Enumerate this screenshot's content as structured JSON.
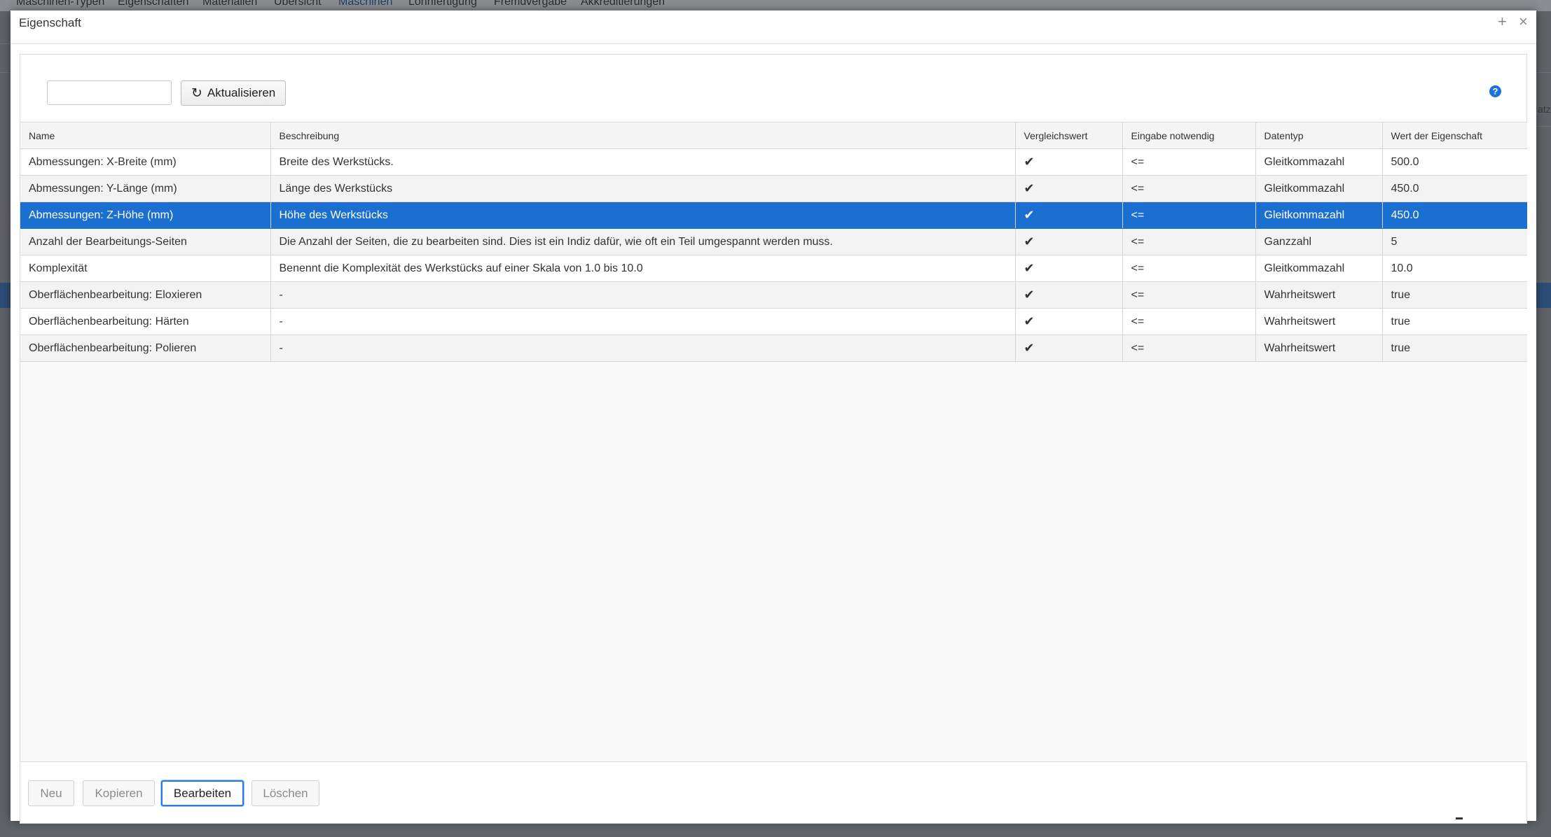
{
  "background": {
    "nav_items": [
      "Maschinen-Typen",
      "Eigenschaften",
      "Materialien",
      "Übersicht",
      "Maschinen",
      "Lohnfertigung",
      "Fremdvergabe",
      "Akkreditierungen"
    ],
    "active_nav": "Maschinen",
    "right_fragment": "atz"
  },
  "dialog": {
    "title": "Eigenschaft",
    "maximize_glyph": "+",
    "close_glyph": "×"
  },
  "toolbar": {
    "search_value": "",
    "refresh_label": "Aktualisieren",
    "refresh_icon": "refresh-icon",
    "help_glyph": "?"
  },
  "table": {
    "columns": [
      "Name",
      "Beschreibung",
      "Vergleichswert",
      "Eingabe notwendig",
      "Datentyp",
      "Wert der Eigenschaft"
    ],
    "selected_index": 2,
    "rows": [
      {
        "name": "Abmessungen: X-Breite (mm)",
        "beschreibung": "Breite des Werkstücks.",
        "vergleichswert": "✔",
        "eingabe": "<=",
        "datentyp": "Gleitkommazahl",
        "wert": "500.0"
      },
      {
        "name": "Abmessungen: Y-Länge (mm)",
        "beschreibung": "Länge des Werkstücks",
        "vergleichswert": "✔",
        "eingabe": "<=",
        "datentyp": "Gleitkommazahl",
        "wert": "450.0"
      },
      {
        "name": "Abmessungen: Z-Höhe (mm)",
        "beschreibung": "Höhe des Werkstücks",
        "vergleichswert": "✔",
        "eingabe": "<=",
        "datentyp": "Gleitkommazahl",
        "wert": "450.0"
      },
      {
        "name": "Anzahl der Bearbeitungs-Seiten",
        "beschreibung": "Die Anzahl der Seiten, die zu bearbeiten sind. Dies ist ein Indiz dafür, wie oft ein Teil umgespannt werden muss.",
        "vergleichswert": "✔",
        "eingabe": "<=",
        "datentyp": "Ganzzahl",
        "wert": "5"
      },
      {
        "name": "Komplexität",
        "beschreibung": "Benennt die Komplexität des Werkstücks auf einer Skala von 1.0 bis 10.0",
        "vergleichswert": "✔",
        "eingabe": "<=",
        "datentyp": "Gleitkommazahl",
        "wert": "10.0"
      },
      {
        "name": "Oberflächenbearbeitung: Eloxieren",
        "beschreibung": "-",
        "vergleichswert": "✔",
        "eingabe": "<=",
        "datentyp": "Wahrheitswert",
        "wert": "true"
      },
      {
        "name": "Oberflächenbearbeitung: Härten",
        "beschreibung": "-",
        "vergleichswert": "✔",
        "eingabe": "<=",
        "datentyp": "Wahrheitswert",
        "wert": "true"
      },
      {
        "name": "Oberflächenbearbeitung: Polieren",
        "beschreibung": "-",
        "vergleichswert": "✔",
        "eingabe": "<=",
        "datentyp": "Wahrheitswert",
        "wert": "true"
      }
    ]
  },
  "footer": {
    "buttons": [
      {
        "label": "Neu",
        "enabled": false
      },
      {
        "label": "Kopieren",
        "enabled": false
      },
      {
        "label": "Bearbeiten",
        "enabled": true
      },
      {
        "label": "Löschen",
        "enabled": false
      }
    ]
  },
  "colors": {
    "selection": "#1b6fd1",
    "help_icon": "#1a73d9",
    "overlay": "#5f6368"
  }
}
